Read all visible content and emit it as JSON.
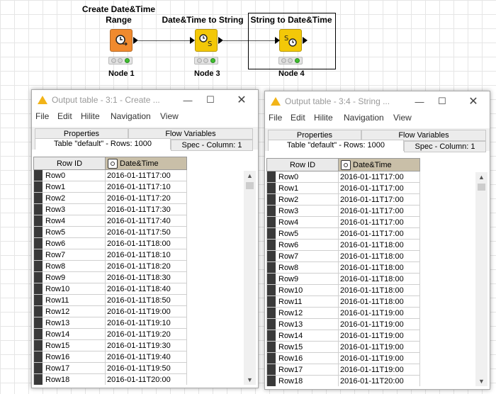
{
  "workflow": {
    "nodes": [
      {
        "title": "Create Date&Time\nRange",
        "label": "Node 1",
        "color": "#f08a2e"
      },
      {
        "title": "Date&Time to String",
        "label": "Node 3",
        "color": "#f3c808"
      },
      {
        "title": "String to Date&Time",
        "label": "Node 4",
        "color": "#f3c808"
      }
    ]
  },
  "menu": [
    "File",
    "Edit",
    "Hilite",
    "Navigation",
    "View"
  ],
  "windows": [
    {
      "title": "Output table - 3:1 - Create ...",
      "tabs": {
        "properties": "Properties",
        "flow_variables": "Flow Variables",
        "table": "Table \"default\" - Rows: 1000",
        "spec": "Spec - Column: 1"
      },
      "columns": [
        "Row ID",
        "Date&Time"
      ],
      "rows": [
        [
          "Row0",
          "2016-01-11T17:00"
        ],
        [
          "Row1",
          "2016-01-11T17:10"
        ],
        [
          "Row2",
          "2016-01-11T17:20"
        ],
        [
          "Row3",
          "2016-01-11T17:30"
        ],
        [
          "Row4",
          "2016-01-11T17:40"
        ],
        [
          "Row5",
          "2016-01-11T17:50"
        ],
        [
          "Row6",
          "2016-01-11T18:00"
        ],
        [
          "Row7",
          "2016-01-11T18:10"
        ],
        [
          "Row8",
          "2016-01-11T18:20"
        ],
        [
          "Row9",
          "2016-01-11T18:30"
        ],
        [
          "Row10",
          "2016-01-11T18:40"
        ],
        [
          "Row11",
          "2016-01-11T18:50"
        ],
        [
          "Row12",
          "2016-01-11T19:00"
        ],
        [
          "Row13",
          "2016-01-11T19:10"
        ],
        [
          "Row14",
          "2016-01-11T19:20"
        ],
        [
          "Row15",
          "2016-01-11T19:30"
        ],
        [
          "Row16",
          "2016-01-11T19:40"
        ],
        [
          "Row17",
          "2016-01-11T19:50"
        ],
        [
          "Row18",
          "2016-01-11T20:00"
        ]
      ]
    },
    {
      "title": "Output table - 3:4 - String ...",
      "tabs": {
        "properties": "Properties",
        "flow_variables": "Flow Variables",
        "table": "Table \"default\" - Rows: 1000",
        "spec": "Spec - Column: 1"
      },
      "columns": [
        "Row ID",
        "Date&Time"
      ],
      "rows": [
        [
          "Row0",
          "2016-01-11T17:00"
        ],
        [
          "Row1",
          "2016-01-11T17:00"
        ],
        [
          "Row2",
          "2016-01-11T17:00"
        ],
        [
          "Row3",
          "2016-01-11T17:00"
        ],
        [
          "Row4",
          "2016-01-11T17:00"
        ],
        [
          "Row5",
          "2016-01-11T17:00"
        ],
        [
          "Row6",
          "2016-01-11T18:00"
        ],
        [
          "Row7",
          "2016-01-11T18:00"
        ],
        [
          "Row8",
          "2016-01-11T18:00"
        ],
        [
          "Row9",
          "2016-01-11T18:00"
        ],
        [
          "Row10",
          "2016-01-11T18:00"
        ],
        [
          "Row11",
          "2016-01-11T18:00"
        ],
        [
          "Row12",
          "2016-01-11T19:00"
        ],
        [
          "Row13",
          "2016-01-11T19:00"
        ],
        [
          "Row14",
          "2016-01-11T19:00"
        ],
        [
          "Row15",
          "2016-01-11T19:00"
        ],
        [
          "Row16",
          "2016-01-11T19:00"
        ],
        [
          "Row17",
          "2016-01-11T19:00"
        ],
        [
          "Row18",
          "2016-01-11T20:00"
        ]
      ]
    }
  ],
  "icons": {
    "minimize": "minimize-icon",
    "maximize": "maximize-icon",
    "close": "close-icon"
  }
}
